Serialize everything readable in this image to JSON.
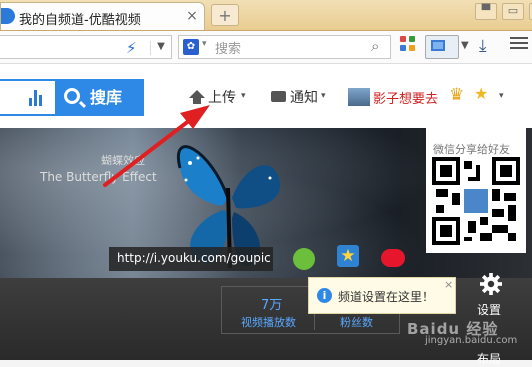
{
  "browser": {
    "tab_title": "我的自频道-优酷视频",
    "tab_close": "×",
    "new_tab": "+",
    "search_placeholder": "搜索",
    "icons": [
      "bolt-icon",
      "paw-icon",
      "search-icon",
      "apps-icon",
      "screenshot-icon",
      "download-icon",
      "menu-icon"
    ]
  },
  "header": {
    "search_button": "搜库",
    "upload": "上传",
    "notice": "通知",
    "user_name": "影子想要去",
    "caret": "▾"
  },
  "banner": {
    "title_cn": "蝴蝶效应",
    "title_en": "The Butterfly Effect",
    "url": "http://i.youku.com/goupic",
    "qr_title": "微信分享给好友"
  },
  "stats": {
    "views_value": "7万",
    "views_label": "视频播放数",
    "fans_label": "粉丝数"
  },
  "tooltip": {
    "text": "频道设置在这里！",
    "icon": "i",
    "close": "×"
  },
  "side": {
    "settings": "设置",
    "layout": "布局"
  },
  "watermark": {
    "main": "Baidu 经验",
    "sub": "jingyan.baidu.com"
  },
  "colors": {
    "accent": "#2e89e6",
    "user_name": "#d32121",
    "annotation": "#e02020"
  }
}
